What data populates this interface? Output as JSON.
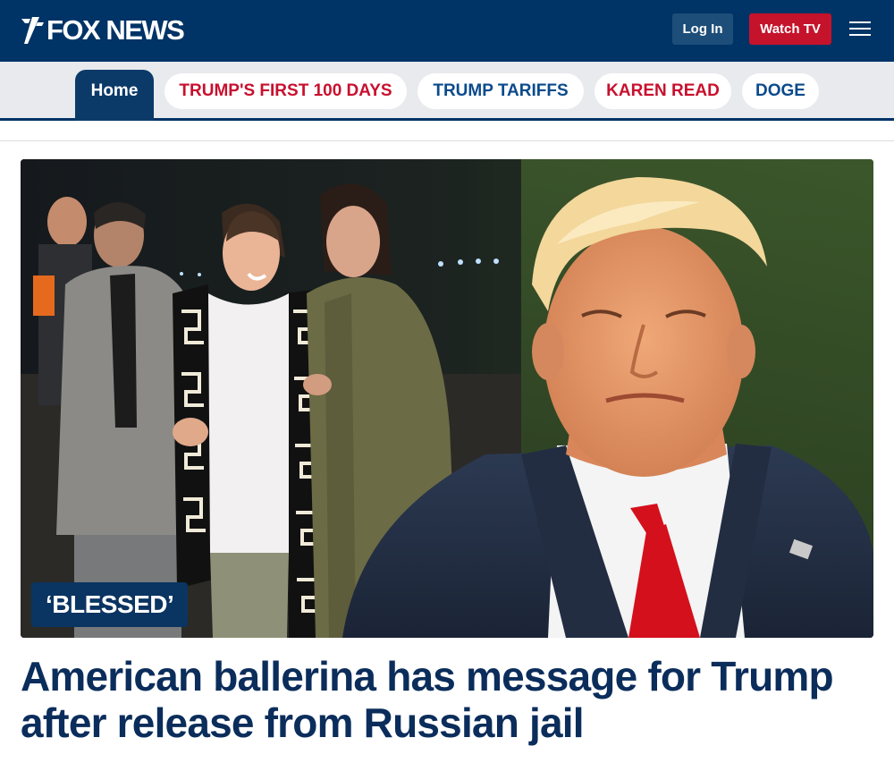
{
  "header": {
    "logo_text": "FOX NEWS",
    "login_label": "Log In",
    "watch_label": "Watch TV",
    "menu_icon": "hamburger-menu-icon"
  },
  "nav": {
    "home_label": "Home",
    "pills": [
      {
        "label": "TRUMP'S FIRST 100 DAYS",
        "color": "#c8102e"
      },
      {
        "label": "TRUMP TARIFFS",
        "color": "#0b4a8c"
      },
      {
        "label": "KAREN READ",
        "color": "#c8102e"
      },
      {
        "label": "DOGE",
        "color": "#0b4a8c"
      }
    ]
  },
  "story": {
    "kicker": "‘BLESSED’",
    "headline": "American ballerina has message for Trump after release from Russian jail"
  },
  "colors": {
    "brand_navy": "#003366",
    "watch_red": "#c5132b",
    "headline_navy": "#0b2d5b"
  }
}
